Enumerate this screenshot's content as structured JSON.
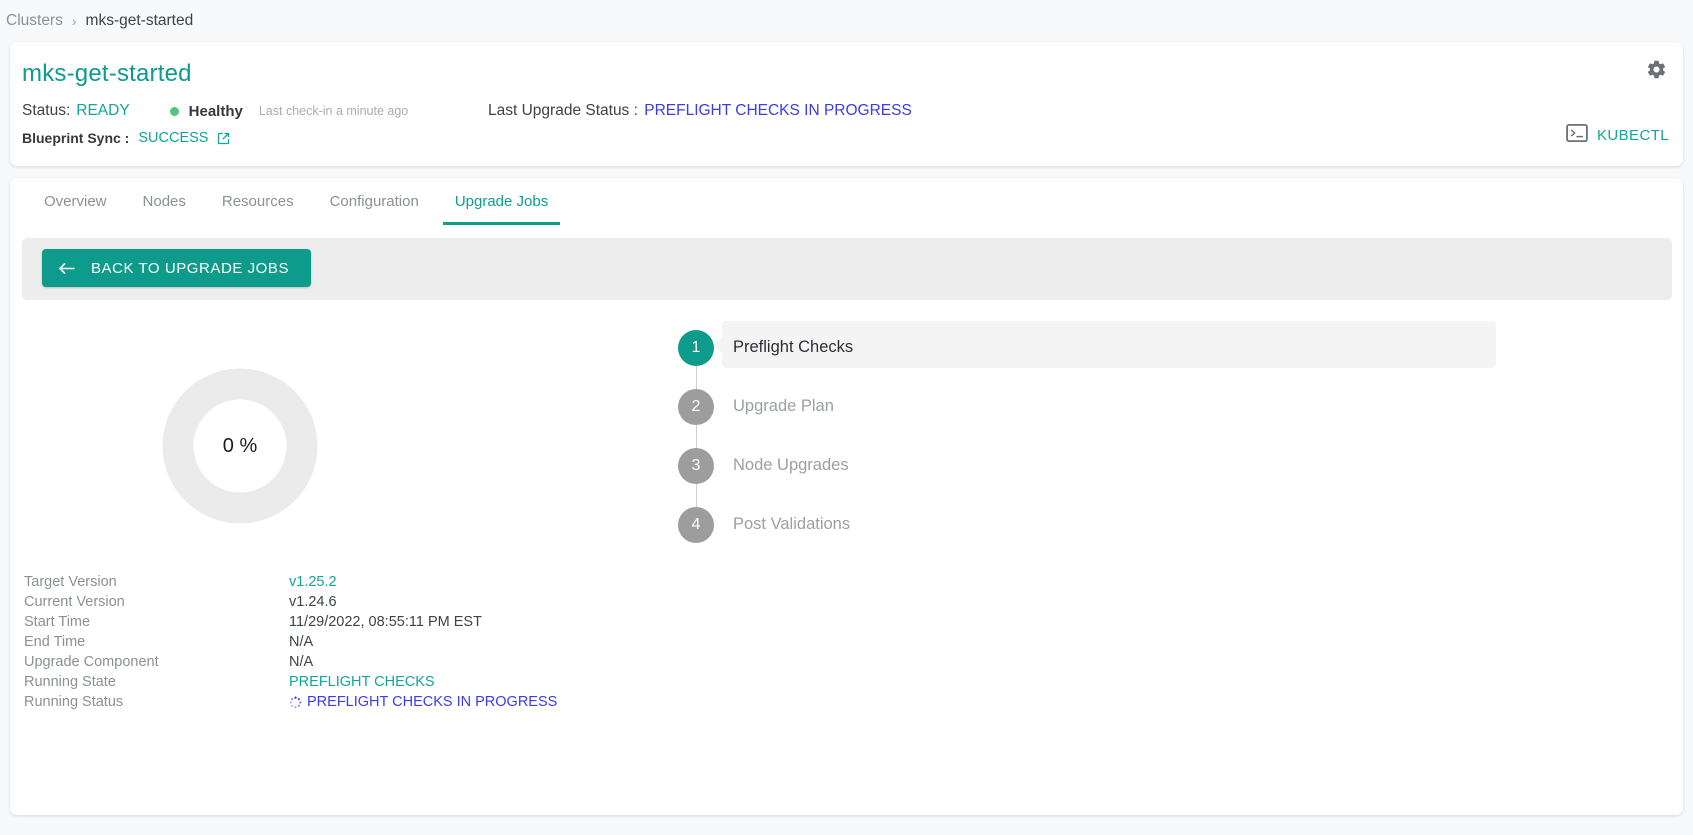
{
  "breadcrumb": {
    "root": "Clusters",
    "separator": "›",
    "current": "mks-get-started"
  },
  "header": {
    "title": "mks-get-started",
    "status_label": "Status:",
    "status_value": "READY",
    "health_text": "Healthy",
    "health_dot_color": "#4ec77f",
    "checkin": "Last check-in a minute ago",
    "blueprint_label": "Blueprint Sync :",
    "blueprint_value": "SUCCESS",
    "blueprint_link_icon": "external-link-icon",
    "upgrade_status_label": "Last Upgrade Status :",
    "upgrade_status_value": "PREFLIGHT CHECKS IN PROGRESS",
    "gear_icon": "gear-icon",
    "kubectl_icon": "terminal-icon",
    "kubectl_label": "KUBECTL",
    "accent_color": "#13a596",
    "link_color": "#3b3bf1"
  },
  "tabs": [
    {
      "label": "Overview",
      "active": false
    },
    {
      "label": "Nodes",
      "active": false
    },
    {
      "label": "Resources",
      "active": false
    },
    {
      "label": "Configuration",
      "active": false
    },
    {
      "label": "Upgrade Jobs",
      "active": true
    }
  ],
  "toolbar": {
    "back_icon": "arrow-left-icon",
    "back_label": "BACK TO UPGRADE JOBS"
  },
  "progress": {
    "percent_text": "0 %",
    "percent_value": 0,
    "track_color": "#ebebeb",
    "fill_color": "#0d9c8c"
  },
  "stepper": [
    {
      "number": "1",
      "label": "Preflight Checks",
      "active": true
    },
    {
      "number": "2",
      "label": "Upgrade Plan",
      "active": false
    },
    {
      "number": "3",
      "label": "Node Upgrades",
      "active": false
    },
    {
      "number": "4",
      "label": "Post Validations",
      "active": false
    }
  ],
  "details": [
    {
      "key": "Target Version",
      "value": "v1.25.2",
      "style": "teal"
    },
    {
      "key": "Current Version",
      "value": "v1.24.6",
      "style": "plain"
    },
    {
      "key": "Start Time",
      "value": "11/29/2022, 08:55:11 PM EST",
      "style": "plain"
    },
    {
      "key": "End Time",
      "value": "N/A",
      "style": "plain"
    },
    {
      "key": "Upgrade Component",
      "value": "N/A",
      "style": "plain"
    },
    {
      "key": "Running State",
      "value": "PREFLIGHT CHECKS",
      "style": "teal"
    },
    {
      "key": "Running Status",
      "value": "PREFLIGHT CHECKS IN PROGRESS",
      "style": "blue",
      "icon": "spinner-icon"
    }
  ]
}
